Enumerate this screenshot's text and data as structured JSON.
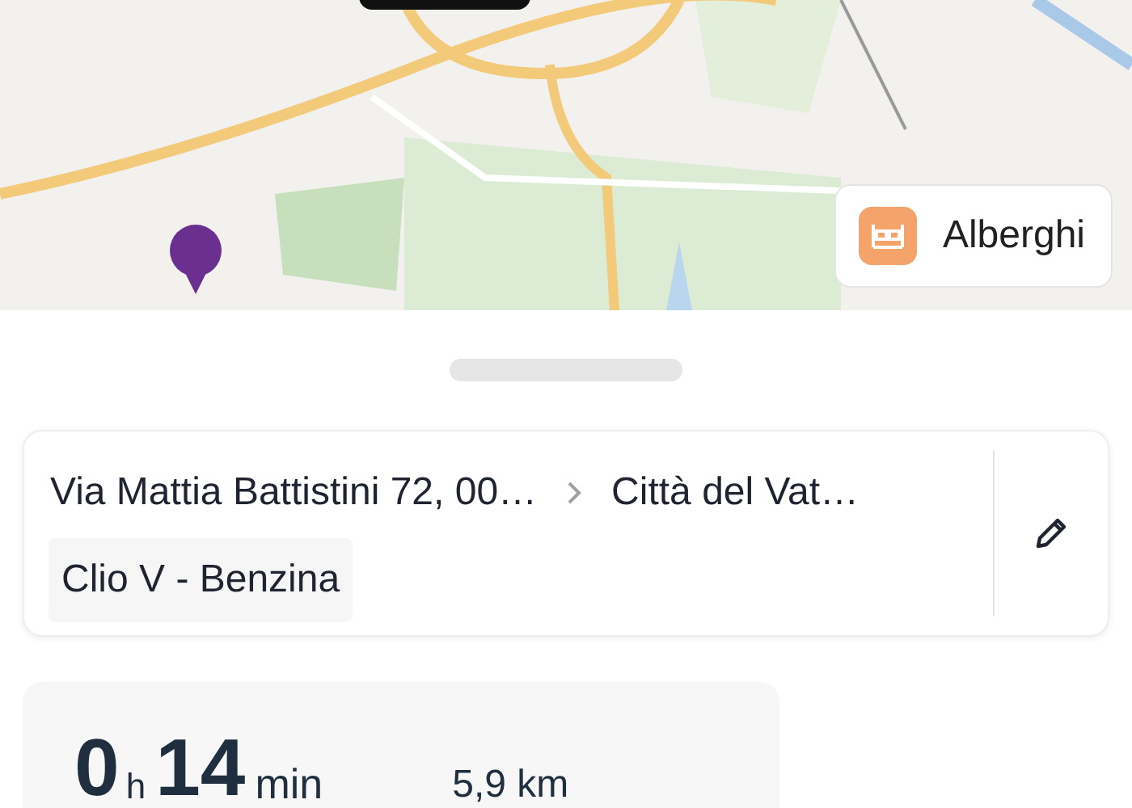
{
  "map": {
    "kind": "picture",
    "hotels_button": {
      "label": "Alberghi"
    }
  },
  "route": {
    "origin": "Via Mattia Battistini 72, 00…",
    "destination": "Città del Vat…",
    "vehicle": "Clio V - Benzina"
  },
  "summary": {
    "hours": "0",
    "hours_unit": "h",
    "minutes": "14",
    "minutes_unit": "min",
    "distance": "5,9 km"
  }
}
